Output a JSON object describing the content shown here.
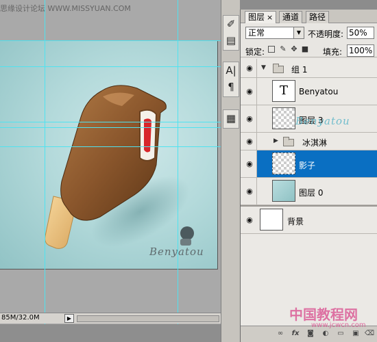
{
  "watermark_top": "思缘设计论坛  WWW.MISSYUAN.COM",
  "canvas": {
    "benyatou_text": "Benyatou",
    "stick_text": "benyatou"
  },
  "status_bar": {
    "doc_size": "85M/32.0M",
    "arrow": "▶"
  },
  "mini_toolbar": {
    "icons": [
      "brush-preset-icon",
      "clone-source-icon",
      "character-icon",
      "paragraph-icon",
      "notes-icon"
    ]
  },
  "layers_panel": {
    "tabs": [
      {
        "label": "图层",
        "active": true
      },
      {
        "label": "通道",
        "active": false
      },
      {
        "label": "路径",
        "active": false
      }
    ],
    "tab_close": "×",
    "blend_mode": "正常",
    "opacity_label": "不透明度:",
    "opacity_value": "50%",
    "lock_label": "锁定:",
    "fill_label": "填充:",
    "fill_value": "100%",
    "layers": [
      {
        "name": "组 1",
        "kind": "group-open",
        "selected": false
      },
      {
        "name": "Benyatou",
        "kind": "text",
        "selected": false,
        "thumb": "T"
      },
      {
        "name": "图层 3",
        "kind": "layer-transparent",
        "selected": false
      },
      {
        "name": "冰淇淋",
        "kind": "group-closed",
        "selected": false
      },
      {
        "name": "影子",
        "kind": "layer-transparent",
        "selected": true
      },
      {
        "name": "图层 0",
        "kind": "layer-teal",
        "selected": false
      },
      {
        "name": "背景",
        "kind": "background",
        "selected": false
      }
    ],
    "footer_icons": [
      "link-icon",
      "fx-icon",
      "mask-icon",
      "adjustment-icon",
      "folder-icon",
      "new-layer-icon",
      "trash-icon"
    ]
  },
  "watermark_bottom": "中国教程网",
  "watermark_url": "www.jcwcn.com",
  "colors": {
    "selection": "#0a6fc2",
    "guide": "#4fe3f0",
    "canvas_bg": "#b4dadb"
  }
}
